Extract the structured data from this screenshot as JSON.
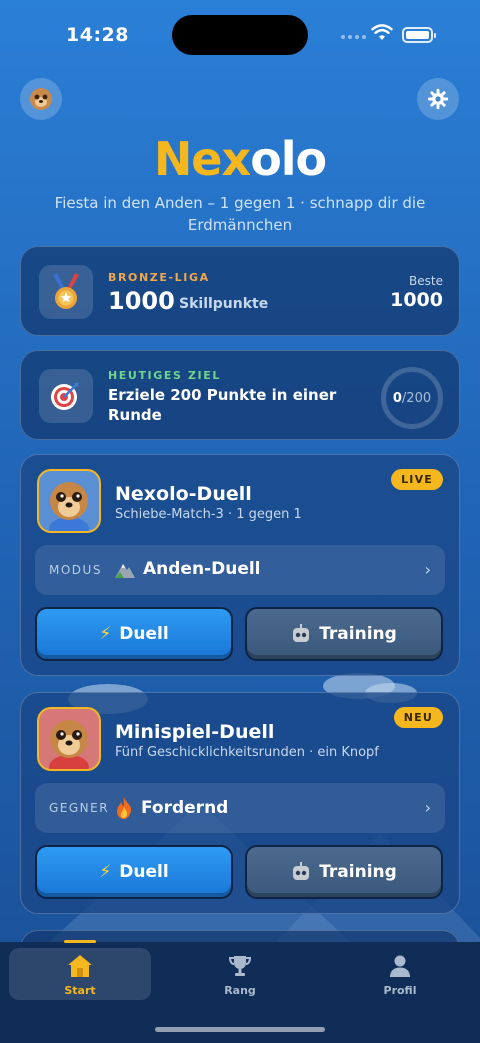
{
  "status": {
    "time": "14:28"
  },
  "header": {
    "logo_part1": "Nex",
    "logo_part2": "olo",
    "subtitle": "Fiesta in den Anden – 1 gegen 1 · schnapp dir die Erdmännchen"
  },
  "league": {
    "eyebrow": "BRONZE-LIGA",
    "points": "1000",
    "points_unit": "Skillpunkte",
    "best_label": "Beste",
    "best_value": "1000",
    "eyebrow_color": "#f0a84a"
  },
  "goal": {
    "eyebrow": "HEUTIGES ZIEL",
    "text": "Erziele 200 Punkte in einer Runde",
    "progress_current": "0",
    "progress_total": "/200",
    "progress_value": 0,
    "eyebrow_color": "#6ed58a"
  },
  "games": [
    {
      "title": "Nexolo-Duell",
      "subtitle": "Schiebe-Match-3 · 1 gegen 1",
      "badge": "LIVE",
      "selector_label": "MODUS",
      "selector_value": "Anden-Duell",
      "primary_label": "Duell",
      "secondary_label": "Training"
    },
    {
      "title": "Minispiel-Duell",
      "subtitle": "Fünf Geschicklichkeitsrunden · ein Knopf",
      "badge": "NEU",
      "selector_label": "GEGNER",
      "selector_value": "Fordernd",
      "primary_label": "Duell",
      "secondary_label": "Training"
    }
  ],
  "tabs": [
    {
      "label": "Start",
      "active": true
    },
    {
      "label": "Rang",
      "active": false
    },
    {
      "label": "Profil",
      "active": false
    }
  ],
  "colors": {
    "accent": "#f5b71e",
    "primary_button": "#1f86e6"
  }
}
